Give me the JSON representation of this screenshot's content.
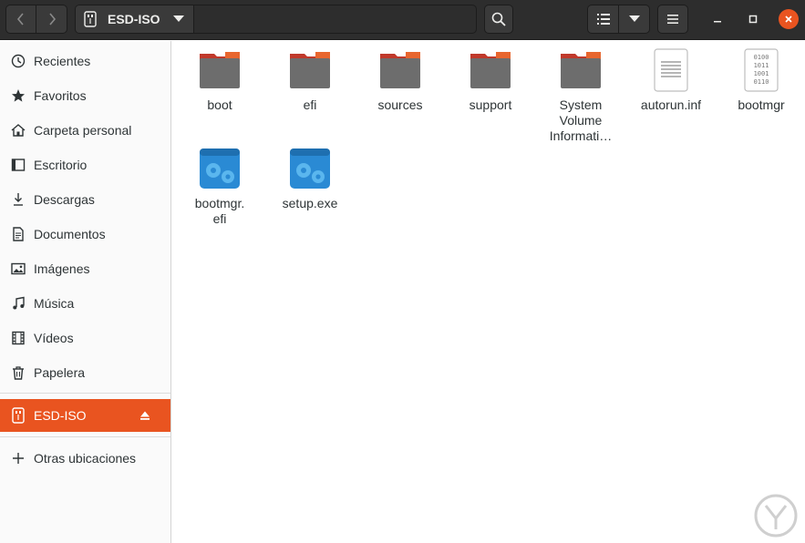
{
  "header": {
    "location_label": "ESD-ISO",
    "buttons": {
      "back": "back",
      "forward": "forward",
      "search": "search",
      "view_list": "list-view",
      "view_options": "view-options",
      "menu": "menu",
      "minimize": "minimize",
      "maximize": "maximize",
      "close": "close"
    }
  },
  "sidebar": {
    "places": [
      {
        "label": "Recientes",
        "icon": "clock-icon"
      },
      {
        "label": "Favoritos",
        "icon": "star-icon"
      },
      {
        "label": "Carpeta personal",
        "icon": "home-icon"
      },
      {
        "label": "Escritorio",
        "icon": "desktop-icon"
      },
      {
        "label": "Descargas",
        "icon": "download-icon"
      },
      {
        "label": "Documentos",
        "icon": "document-icon"
      },
      {
        "label": "Imágenes",
        "icon": "image-icon"
      },
      {
        "label": "Música",
        "icon": "music-icon"
      },
      {
        "label": "Vídeos",
        "icon": "video-icon"
      },
      {
        "label": "Papelera",
        "icon": "trash-icon"
      }
    ],
    "devices": [
      {
        "label": "ESD-ISO",
        "icon": "usb-icon",
        "active": true
      }
    ],
    "other": {
      "label": "Otras ubicaciones",
      "icon": "plus-icon"
    }
  },
  "files": [
    {
      "name": "boot",
      "type": "folder"
    },
    {
      "name": "efi",
      "type": "folder"
    },
    {
      "name": "sources",
      "type": "folder"
    },
    {
      "name": "support",
      "type": "folder"
    },
    {
      "name": "System Volume Informati…",
      "type": "folder"
    },
    {
      "name": "autorun.inf",
      "type": "text"
    },
    {
      "name": "bootmgr",
      "type": "binary"
    },
    {
      "name": "bootmgr.\nefi",
      "type": "executable"
    },
    {
      "name": "setup.exe",
      "type": "executable"
    }
  ],
  "colors": {
    "accent": "#e95420",
    "folder_tab": "#c0392b",
    "folder_body": "#6d6d6d",
    "exe_blue": "#2a8ad4",
    "header_bg": "#2d2d2d"
  }
}
